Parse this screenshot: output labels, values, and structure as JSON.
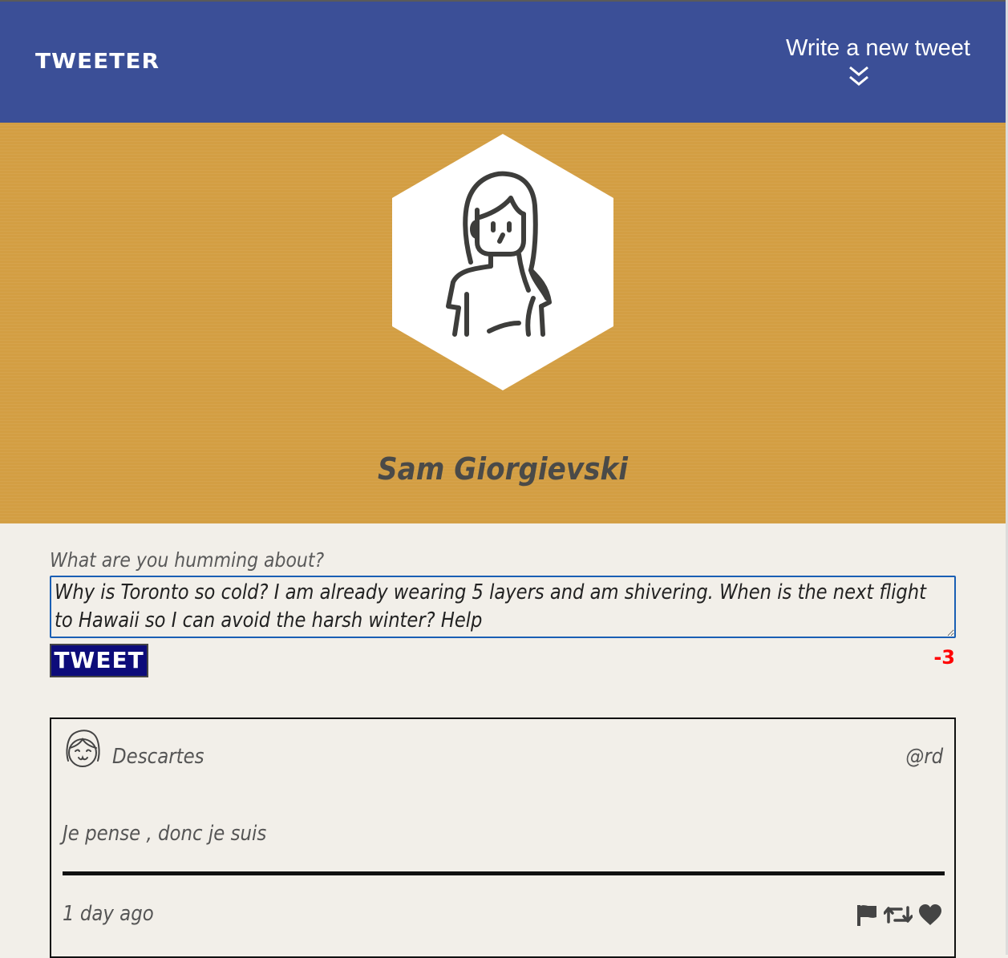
{
  "nav": {
    "brand": "TWEETER",
    "compose_toggle_label": "Write a new tweet",
    "compose_toggle_icon": "double-chevron-down-icon"
  },
  "profile": {
    "name": "Sam Giorgievski",
    "avatar_icon": "woman-avatar-icon",
    "banner_color": "#d39e43"
  },
  "compose": {
    "prompt": "What are you humming about?",
    "textarea_value": "Why is Toronto so cold? I am already wearing 5 layers and am shivering. When is the next flight to Hawaii so I can avoid the harsh winter? Help",
    "textarea_line1": "Why is Toronto so cold? I am already wearing 5 layers and am shivering. When is the next flight",
    "textarea_line2": "to Hawaii so I can avoid the harsh winter? Help",
    "submit_label": "TWEET",
    "char_counter": "-3"
  },
  "tweets": [
    {
      "author": "Descartes",
      "handle": "@rd",
      "content": "Je pense , donc je suis",
      "timestamp": "1 day ago",
      "avatar_icon": "smiling-girl-avatar-icon",
      "actions": [
        "flag-icon",
        "retweet-icon",
        "heart-icon"
      ]
    }
  ],
  "colors": {
    "nav": "#3b4f97",
    "page": "#f2efe9",
    "button": "#0d0c7a",
    "counter": "#ff0000"
  }
}
